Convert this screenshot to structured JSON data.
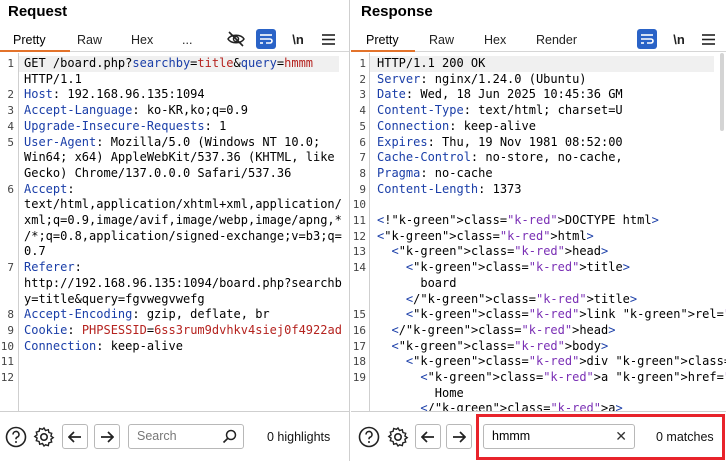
{
  "request": {
    "title": "Request",
    "tabs": [
      "Pretty",
      "Raw",
      "Hex",
      "..."
    ],
    "icons": {
      "hide": "eye-off-icon",
      "wrap": "wrap-icon",
      "newline": "\\n",
      "menu": "hamburger-icon"
    },
    "lines": [
      {
        "num": "1",
        "text": "GET /board.php?searchby=title&query=hmmm"
      },
      {
        "num": "",
        "text": "HTTP/1.1"
      },
      {
        "num": "2",
        "text": "Host: 192.168.96.135:1094"
      },
      {
        "num": "3",
        "text": "Accept-Language: ko-KR,ko;q=0.9"
      },
      {
        "num": "4",
        "text": "Upgrade-Insecure-Requests: 1"
      },
      {
        "num": "5",
        "text": "User-Agent: Mozilla/5.0 (Windows NT 10.0;"
      },
      {
        "num": "",
        "text": "Win64; x64) AppleWebKit/537.36 (KHTML, like"
      },
      {
        "num": "",
        "text": "Gecko) Chrome/137.0.0.0 Safari/537.36"
      },
      {
        "num": "6",
        "text": "Accept:"
      },
      {
        "num": "",
        "text": "text/html,application/xhtml+xml,application/"
      },
      {
        "num": "",
        "text": "xml;q=0.9,image/avif,image/webp,image/apng,*"
      },
      {
        "num": "",
        "text": "/*;q=0.8,application/signed-exchange;v=b3;q="
      },
      {
        "num": "",
        "text": "0.7"
      },
      {
        "num": "7",
        "text": "Referer:"
      },
      {
        "num": "",
        "text": "http://192.168.96.135:1094/board.php?searchb"
      },
      {
        "num": "",
        "text": "y=title&query=fgvwegvwefg"
      },
      {
        "num": "8",
        "text": "Accept-Encoding: gzip, deflate, br"
      },
      {
        "num": "9",
        "text": "Cookie: PHPSESSID=6ss3rum9dvhkv4siej0f4922ad"
      },
      {
        "num": "10",
        "text": "Connection: keep-alive"
      },
      {
        "num": "11",
        "text": ""
      },
      {
        "num": "12",
        "text": ""
      }
    ],
    "bottom": {
      "search_placeholder": "Search",
      "highlights": "0 highlights"
    }
  },
  "response": {
    "title": "Response",
    "tabs": [
      "Pretty",
      "Raw",
      "Hex",
      "Render"
    ],
    "lines": [
      {
        "num": "1",
        "text": "HTTP/1.1 200 OK"
      },
      {
        "num": "2",
        "text": "Server: nginx/1.24.0 (Ubuntu)"
      },
      {
        "num": "3",
        "text": "Date: Wed, 18 Jun 2025 10:45:36 GM"
      },
      {
        "num": "4",
        "text": "Content-Type: text/html; charset=U"
      },
      {
        "num": "5",
        "text": "Connection: keep-alive"
      },
      {
        "num": "6",
        "text": "Expires: Thu, 19 Nov 1981 08:52:00"
      },
      {
        "num": "7",
        "text": "Cache-Control: no-store, no-cache,"
      },
      {
        "num": "8",
        "text": "Pragma: no-cache"
      },
      {
        "num": "9",
        "text": "Content-Length: 1373"
      },
      {
        "num": "10",
        "text": ""
      },
      {
        "num": "11",
        "text": "<!DOCTYPE html>"
      },
      {
        "num": "12",
        "text": "<html>"
      },
      {
        "num": "13",
        "text": "  <head>"
      },
      {
        "num": "14",
        "text": "    <title>"
      },
      {
        "num": "",
        "text": "      board"
      },
      {
        "num": "",
        "text": "    </title>"
      },
      {
        "num": "15",
        "text": "    <link rel=\"stylesheet\" href=\"s"
      },
      {
        "num": "16",
        "text": "  </head>"
      },
      {
        "num": "17",
        "text": "  <body>"
      },
      {
        "num": "18",
        "text": "    <div class=\"logo\">"
      },
      {
        "num": "19",
        "text": "      <a href=\"board.php\">"
      },
      {
        "num": "",
        "text": "        Home"
      },
      {
        "num": "",
        "text": "      </a>"
      }
    ],
    "bottom": {
      "search_value": "hmmm",
      "matches": "0 matches"
    }
  }
}
